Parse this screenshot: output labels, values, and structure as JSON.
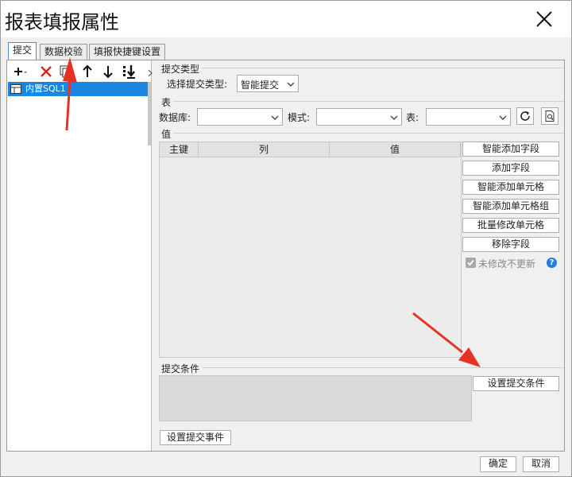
{
  "dialog": {
    "title": "报表填报属性"
  },
  "tabs": [
    {
      "label": "提交"
    },
    {
      "label": "数据校验"
    },
    {
      "label": "填报快捷键设置"
    }
  ],
  "tree": {
    "items": [
      {
        "label": "内置SQL1"
      }
    ]
  },
  "submit_type": {
    "section": "提交类型",
    "label": "选择提交类型:",
    "value": "智能提交"
  },
  "table_section": {
    "section": "表",
    "database_label": "数据库:",
    "database_value": "",
    "schema_label": "模式:",
    "schema_value": "",
    "table_label": "表:",
    "table_value": ""
  },
  "values_section": {
    "section": "值",
    "columns": [
      "主键",
      "列",
      "值"
    ],
    "rows": [],
    "buttons": {
      "smart_add_field": "智能添加字段",
      "add_field": "添加字段",
      "smart_add_cell": "智能添加单元格",
      "smart_add_cell_group": "智能添加单元格组",
      "batch_modify_cell": "批量修改单元格",
      "remove_field": "移除字段"
    },
    "no_update_unmodified": {
      "label": "未修改不更新",
      "checked": true
    }
  },
  "condition_section": {
    "section": "提交条件",
    "button": "设置提交条件"
  },
  "event_button": "设置提交事件",
  "footer": {
    "ok": "确定",
    "cancel": "取消"
  },
  "colors": {
    "accent": "#1b86e0",
    "annotation_arrow": "#e63223",
    "delete": "#e02020"
  }
}
